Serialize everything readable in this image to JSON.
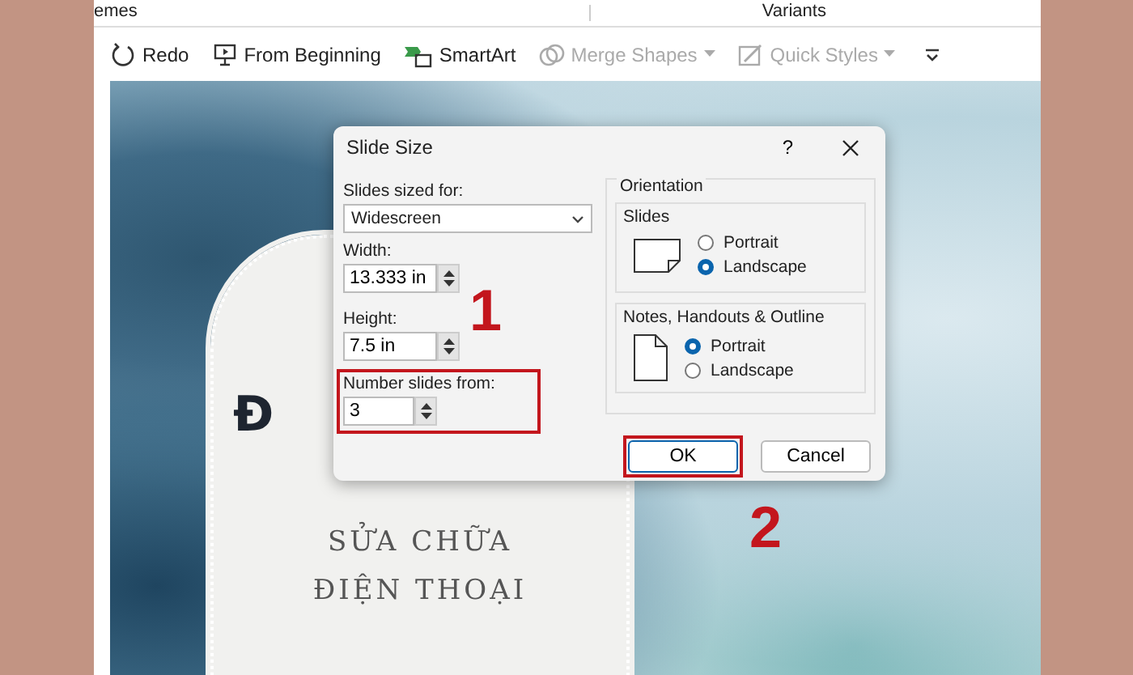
{
  "ribbon": {
    "group_labels": [
      "emes",
      "Variants"
    ],
    "tools": [
      {
        "kind": "redo",
        "label": "Redo",
        "disabled": false,
        "dropdown": false
      },
      {
        "kind": "present",
        "label": "From Beginning",
        "disabled": false,
        "dropdown": false
      },
      {
        "kind": "smartart",
        "label": "SmartArt",
        "disabled": false,
        "dropdown": false
      },
      {
        "kind": "merge",
        "label": "Merge Shapes",
        "disabled": true,
        "dropdown": true
      },
      {
        "kind": "styles",
        "label": "Quick Styles",
        "disabled": true,
        "dropdown": true
      }
    ]
  },
  "slide": {
    "title": "Đ",
    "subtitle_lines": [
      "SỬA CHỮA",
      "ĐIỆN THOẠI"
    ]
  },
  "dialog": {
    "title": "Slide Size",
    "help": "?",
    "sized_for": {
      "label": "Slides sized for:",
      "value": "Widescreen"
    },
    "fields": [
      {
        "label": "Width:",
        "value": "13.333 in",
        "highlighted": false
      },
      {
        "label": "Height:",
        "value": "7.5 in",
        "highlighted": false
      },
      {
        "label": "Number slides from:",
        "value": "3",
        "highlighted": true
      }
    ],
    "orientation": {
      "label": "Orientation",
      "groups": [
        {
          "label": "Slides",
          "kind": "landscape",
          "options": [
            {
              "label": "Portrait",
              "selected": false
            },
            {
              "label": "Landscape",
              "selected": true
            }
          ]
        },
        {
          "label": "Notes, Handouts & Outline",
          "kind": "portrait",
          "options": [
            {
              "label": "Portrait",
              "selected": true
            },
            {
              "label": "Landscape",
              "selected": false
            }
          ]
        }
      ]
    },
    "buttons": [
      {
        "label": "OK",
        "default": true,
        "highlighted": true
      },
      {
        "label": "Cancel",
        "default": false,
        "highlighted": false
      }
    ]
  },
  "annotations": [
    {
      "number": "1"
    },
    {
      "number": "2"
    }
  ]
}
